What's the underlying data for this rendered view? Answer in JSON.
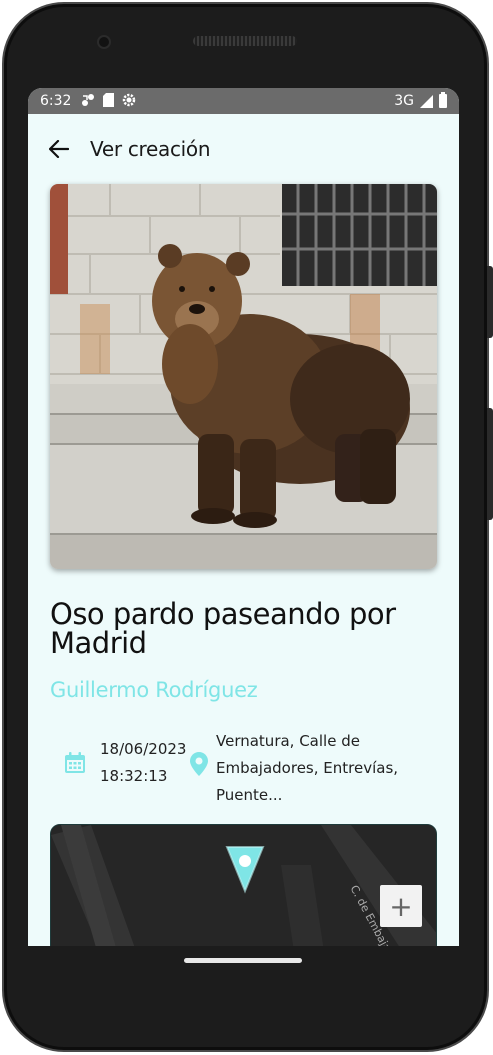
{
  "status_bar": {
    "time": "6:32",
    "network": "3G",
    "icons": [
      "sync-icon",
      "sd-card-icon",
      "settings-gear-icon",
      "signal-icon",
      "battery-icon"
    ]
  },
  "app_bar": {
    "title": "Ver creación",
    "back_icon": "arrow-left-icon"
  },
  "creation": {
    "image_alt": "brown bear",
    "title": "Oso pardo paseando por Madrid",
    "author": "Guillermo Rodríguez",
    "date": "18/06/2023",
    "time": "18:32:13",
    "location": "Vernatura, Calle de Embajadores, Entrevías, Puente..."
  },
  "map": {
    "zoom_in_label": "+",
    "street_label": "C. de Embajadores"
  },
  "colors": {
    "accent": "#7fe5e6",
    "background": "#eefbfb",
    "map_bg": "#262626",
    "status_bar": "#6b6b6b"
  }
}
